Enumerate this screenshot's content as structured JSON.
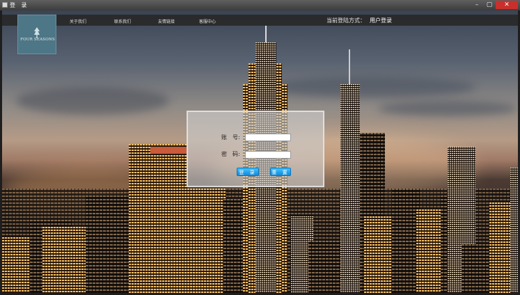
{
  "window": {
    "title": "登 录",
    "min_glyph": "–",
    "max_glyph": "▢",
    "close_glyph": "✕"
  },
  "nav": {
    "items": [
      "关于我们",
      "联系我们",
      "友情链接",
      "客服中心"
    ],
    "login_mode_label": "当前登陆方式：",
    "user_login_link": "用户登录"
  },
  "logo": {
    "text": "FOUR SEASONS",
    "icon": "tree-icon",
    "color": "#4d7686"
  },
  "login_form": {
    "account_label": "账　号:",
    "account_value": "",
    "password_label": "密　码:",
    "password_value": "",
    "login_button": "登 录",
    "reset_button": "重 置",
    "button_color": "#1ea0ec"
  }
}
